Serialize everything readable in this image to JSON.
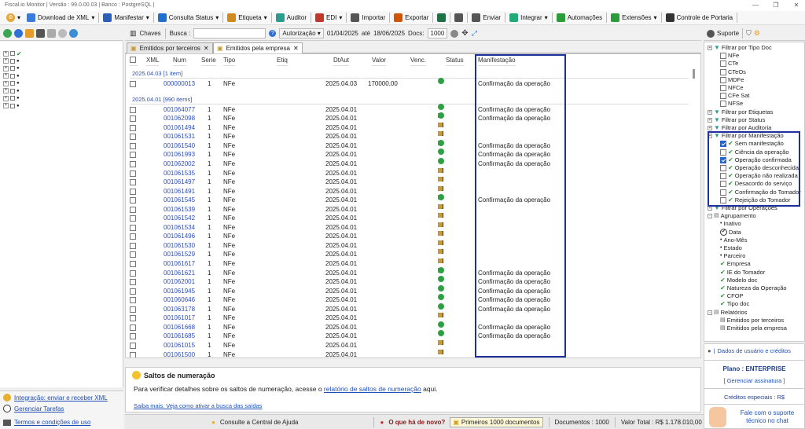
{
  "window": {
    "title": "Fiscal.io Monitor | Versão : 99.0.00.03 | Banco : PostgreSQL |"
  },
  "toolbar": {
    "items": [
      {
        "label": "Download de XML",
        "icon": "xml-icon",
        "dropdown": true,
        "color": "#3d7bd9"
      },
      {
        "label": "Manifestar",
        "icon": "manifest-icon",
        "dropdown": true,
        "color": "#2b5fb8"
      },
      {
        "label": "Consulta Status",
        "icon": "status-icon",
        "dropdown": true,
        "color": "#1e6fd0"
      },
      {
        "label": "Etiqueta",
        "icon": "tag-icon",
        "dropdown": true,
        "color": "#d08a1e"
      },
      {
        "label": "Auditor",
        "icon": "auditor-icon",
        "dropdown": false,
        "color": "#2a9d8f"
      },
      {
        "label": "EDI",
        "icon": "edi-icon",
        "dropdown": true,
        "color": "#c0392b"
      },
      {
        "label": "Importar",
        "icon": "import-icon",
        "dropdown": false,
        "color": "#555"
      },
      {
        "label": "Exportar",
        "icon": "export-icon",
        "dropdown": false,
        "color": "#d35400"
      },
      {
        "label": "",
        "icon": "excel-icon",
        "dropdown": false,
        "color": "#1e7145"
      },
      {
        "label": "",
        "icon": "printer-icon",
        "dropdown": false,
        "color": "#555"
      },
      {
        "label": "Enviar",
        "icon": "mail-icon",
        "dropdown": false,
        "color": "#555"
      },
      {
        "label": "Integrar",
        "icon": "integrate-icon",
        "dropdown": true,
        "color": "#2a7"
      },
      {
        "label": "Automações",
        "icon": "automation-icon",
        "dropdown": false,
        "color": "#2a9d3a"
      },
      {
        "label": "Extensões",
        "icon": "extension-icon",
        "dropdown": true,
        "color": "#2a9d3a"
      },
      {
        "label": "Controle de Portaria",
        "icon": "gate-icon",
        "dropdown": false,
        "color": "#333"
      }
    ]
  },
  "filter": {
    "chaves": "Chaves",
    "busca_label": "Busca :",
    "help": "?",
    "autorizacao": "Autorização",
    "date_from": "01/04/2025",
    "ate": "até",
    "date_to": "18/06/2025",
    "docs_label": "Docs:",
    "docs": "1000"
  },
  "tabs": [
    {
      "label": "Emitidos por terceiros",
      "active": false
    },
    {
      "label": "Emitidos pela empresa",
      "active": true
    }
  ],
  "grid": {
    "headers": {
      "xml": "XML",
      "num": "Num",
      "serie": "Serie",
      "tipo": "Tipo",
      "etiq": "Etiq",
      "dtaut": "DtAut",
      "valor": "Valor",
      "venc": "Venc.",
      "status": "Status",
      "manif": "Manifestação"
    },
    "groups": [
      {
        "label": "2025.04.03 [1 item]"
      },
      {
        "label": "2025.04.01 [990 items]"
      }
    ],
    "rows": [
      {
        "group": 0,
        "num": "000000013",
        "serie": "1",
        "tipo": "NFe",
        "dtaut": "2025.04.03",
        "valor": "170000,00",
        "status": "g",
        "manif": "Confirmação da operação"
      },
      {
        "group": 1,
        "num": "001064077",
        "serie": "1",
        "tipo": "NFe",
        "dtaut": "2025.04.01",
        "valor": "",
        "status": "g",
        "manif": "Confirmação da operação"
      },
      {
        "group": 1,
        "num": "001062098",
        "serie": "1",
        "tipo": "NFe",
        "dtaut": "2025.04.01",
        "valor": "",
        "status": "bg",
        "manif": "Confirmação da operação"
      },
      {
        "group": 1,
        "num": "001061494",
        "serie": "1",
        "tipo": "NFe",
        "dtaut": "2025.04.01",
        "valor": "",
        "status": "b",
        "manif": ""
      },
      {
        "group": 1,
        "num": "001061531",
        "serie": "1",
        "tipo": "NFe",
        "dtaut": "2025.04.01",
        "valor": "",
        "status": "b",
        "manif": ""
      },
      {
        "group": 1,
        "num": "001061540",
        "serie": "1",
        "tipo": "NFe",
        "dtaut": "2025.04.01",
        "valor": "",
        "status": "bg",
        "manif": "Confirmação da operação"
      },
      {
        "group": 1,
        "num": "001061993",
        "serie": "1",
        "tipo": "NFe",
        "dtaut": "2025.04.01",
        "valor": "",
        "status": "g",
        "manif": "Confirmação da operação"
      },
      {
        "group": 1,
        "num": "001062002",
        "serie": "1",
        "tipo": "NFe",
        "dtaut": "2025.04.01",
        "valor": "",
        "status": "g",
        "manif": "Confirmação da operação"
      },
      {
        "group": 1,
        "num": "001061535",
        "serie": "1",
        "tipo": "NFe",
        "dtaut": "2025.04.01",
        "valor": "",
        "status": "b",
        "manif": ""
      },
      {
        "group": 1,
        "num": "001061497",
        "serie": "1",
        "tipo": "NFe",
        "dtaut": "2025.04.01",
        "valor": "",
        "status": "b",
        "manif": ""
      },
      {
        "group": 1,
        "num": "001061491",
        "serie": "1",
        "tipo": "NFe",
        "dtaut": "2025.04.01",
        "valor": "",
        "status": "b",
        "manif": ""
      },
      {
        "group": 1,
        "num": "001061545",
        "serie": "1",
        "tipo": "NFe",
        "dtaut": "2025.04.01",
        "valor": "",
        "status": "bg",
        "manif": "Confirmação da operação"
      },
      {
        "group": 1,
        "num": "001061539",
        "serie": "1",
        "tipo": "NFe",
        "dtaut": "2025.04.01",
        "valor": "",
        "status": "b",
        "manif": ""
      },
      {
        "group": 1,
        "num": "001061542",
        "serie": "1",
        "tipo": "NFe",
        "dtaut": "2025.04.01",
        "valor": "",
        "status": "b",
        "manif": ""
      },
      {
        "group": 1,
        "num": "001061534",
        "serie": "1",
        "tipo": "NFe",
        "dtaut": "2025.04.01",
        "valor": "",
        "status": "b",
        "manif": ""
      },
      {
        "group": 1,
        "num": "001061496",
        "serie": "1",
        "tipo": "NFe",
        "dtaut": "2025.04.01",
        "valor": "",
        "status": "b",
        "manif": ""
      },
      {
        "group": 1,
        "num": "001061530",
        "serie": "1",
        "tipo": "NFe",
        "dtaut": "2025.04.01",
        "valor": "",
        "status": "b",
        "manif": ""
      },
      {
        "group": 1,
        "num": "001061529",
        "serie": "1",
        "tipo": "NFe",
        "dtaut": "2025.04.01",
        "valor": "",
        "status": "b",
        "manif": ""
      },
      {
        "group": 1,
        "num": "001061617",
        "serie": "1",
        "tipo": "NFe",
        "dtaut": "2025.04.01",
        "valor": "",
        "status": "b",
        "manif": ""
      },
      {
        "group": 1,
        "num": "001061621",
        "serie": "1",
        "tipo": "NFe",
        "dtaut": "2025.04.01",
        "valor": "",
        "status": "bg",
        "manif": "Confirmação da operação"
      },
      {
        "group": 1,
        "num": "001062001",
        "serie": "1",
        "tipo": "NFe",
        "dtaut": "2025.04.01",
        "valor": "",
        "status": "g",
        "manif": "Confirmação da operação"
      },
      {
        "group": 1,
        "num": "001061945",
        "serie": "1",
        "tipo": "NFe",
        "dtaut": "2025.04.01",
        "valor": "",
        "status": "g",
        "manif": "Confirmação da operação"
      },
      {
        "group": 1,
        "num": "001060646",
        "serie": "1",
        "tipo": "NFe",
        "dtaut": "2025.04.01",
        "valor": "",
        "status": "g",
        "manif": "Confirmação da operação"
      },
      {
        "group": 1,
        "num": "001063178",
        "serie": "1",
        "tipo": "NFe",
        "dtaut": "2025.04.01",
        "valor": "",
        "status": "g",
        "manif": "Confirmação da operação"
      },
      {
        "group": 1,
        "num": "001061017",
        "serie": "1",
        "tipo": "NFe",
        "dtaut": "2025.04.01",
        "valor": "",
        "status": "b",
        "manif": ""
      },
      {
        "group": 1,
        "num": "001061668",
        "serie": "1",
        "tipo": "NFe",
        "dtaut": "2025.04.01",
        "valor": "",
        "status": "g",
        "manif": "Confirmação da operação"
      },
      {
        "group": 1,
        "num": "001061685",
        "serie": "1",
        "tipo": "NFe",
        "dtaut": "2025.04.01",
        "valor": "",
        "status": "g",
        "manif": "Confirmação da operação"
      },
      {
        "group": 1,
        "num": "001061015",
        "serie": "1",
        "tipo": "NFe",
        "dtaut": "2025.04.01",
        "valor": "",
        "status": "b",
        "manif": ""
      },
      {
        "group": 1,
        "num": "001061500",
        "serie": "1",
        "tipo": "NFe",
        "dtaut": "2025.04.01",
        "valor": "",
        "status": "b",
        "manif": ""
      }
    ]
  },
  "info": {
    "title": "Saltos de numeração",
    "text": "Para verificar detalhes sobre os saltos de numeração, acesse o",
    "link": "relatório de saltos de numeração",
    "after": "aqui.",
    "more": "Saiba mais. Veja como ativar a busca das saídas"
  },
  "left_bottom": {
    "integracao": "Integração: enviar e receber XML",
    "tarefas": "Gerenciar Tarefas",
    "termos": "Termos e condições de uso"
  },
  "status": {
    "ajuda": "Consulte a Central de Ajuda",
    "novo": "O que há de novo?",
    "primeiros": "Primeiros 1000 documentos",
    "documentos": "Documentos : 1000",
    "valor": "Valor Total : R$ 1.178.010,00"
  },
  "right": {
    "suporte": "Suporte",
    "items": [
      {
        "label": "Filtrar por Tipo Doc",
        "level": 0,
        "type": "filter"
      },
      {
        "label": "NFe",
        "level": 1,
        "type": "cb"
      },
      {
        "label": "CTe",
        "level": 1,
        "type": "cb"
      },
      {
        "label": "CTeOs",
        "level": 1,
        "type": "cb"
      },
      {
        "label": "MDFe",
        "level": 1,
        "type": "cb"
      },
      {
        "label": "NFCe",
        "level": 1,
        "type": "cb"
      },
      {
        "label": "CFe Sat",
        "level": 1,
        "type": "cb"
      },
      {
        "label": "NFSe",
        "level": 1,
        "type": "cb"
      },
      {
        "label": "Filtrar por Etiquetas",
        "level": 0,
        "type": "filter"
      },
      {
        "label": "Filtrar por Status",
        "level": 0,
        "type": "filter"
      },
      {
        "label": "Filtrar por Auditoria",
        "level": 0,
        "type": "filter"
      },
      {
        "label": "Filtrar por Manifestação",
        "level": 0,
        "type": "filter"
      },
      {
        "label": "Sem manifestação",
        "level": 1,
        "type": "cbx"
      },
      {
        "label": "Ciência da operação",
        "level": 1,
        "type": "cbg"
      },
      {
        "label": "Operação confirmada",
        "level": 1,
        "type": "cbx"
      },
      {
        "label": "Operação desconhecida",
        "level": 1,
        "type": "cbg"
      },
      {
        "label": "Operação não realizada",
        "level": 1,
        "type": "cbg"
      },
      {
        "label": "Desacordo do serviço",
        "level": 1,
        "type": "cbg"
      },
      {
        "label": "Confirmação do Tomador",
        "level": 1,
        "type": "cbg"
      },
      {
        "label": "Rejeição do Tomador",
        "level": 1,
        "type": "cbg"
      },
      {
        "label": "Filtrar por Operações",
        "level": 0,
        "type": "filter"
      },
      {
        "label": "Agrupamento",
        "level": 0,
        "type": "group"
      },
      {
        "label": "Inativo",
        "level": 1,
        "type": "dot"
      },
      {
        "label": "Data",
        "level": 1,
        "type": "radio"
      },
      {
        "label": "Ano-Mês",
        "level": 1,
        "type": "dot"
      },
      {
        "label": "Estado",
        "level": 1,
        "type": "dot"
      },
      {
        "label": "Parceiro",
        "level": 1,
        "type": "dot"
      },
      {
        "label": "Empresa",
        "level": 1,
        "type": "chk"
      },
      {
        "label": "IE do Tomador",
        "level": 1,
        "type": "chk"
      },
      {
        "label": "Modelo doc",
        "level": 1,
        "type": "chk"
      },
      {
        "label": "Natureza da Operação",
        "level": 1,
        "type": "chk"
      },
      {
        "label": "CFOP",
        "level": 1,
        "type": "chk"
      },
      {
        "label": "Tipo doc",
        "level": 1,
        "type": "chk"
      },
      {
        "label": "Relatórios",
        "level": 0,
        "type": "group"
      },
      {
        "label": "Emitidos por terceiros",
        "level": 1,
        "type": "doc"
      },
      {
        "label": "Emitidos pela empresa",
        "level": 1,
        "type": "doc"
      }
    ],
    "dados": "Dados de usuário e créditos",
    "plano": "Plano : ENTERPRISE",
    "gerenciar": "Gerenciar assinatura",
    "creditos": "Créditos especiais : R$",
    "chat1": "Fale com o suporte",
    "chat2": "técnico no chat"
  }
}
